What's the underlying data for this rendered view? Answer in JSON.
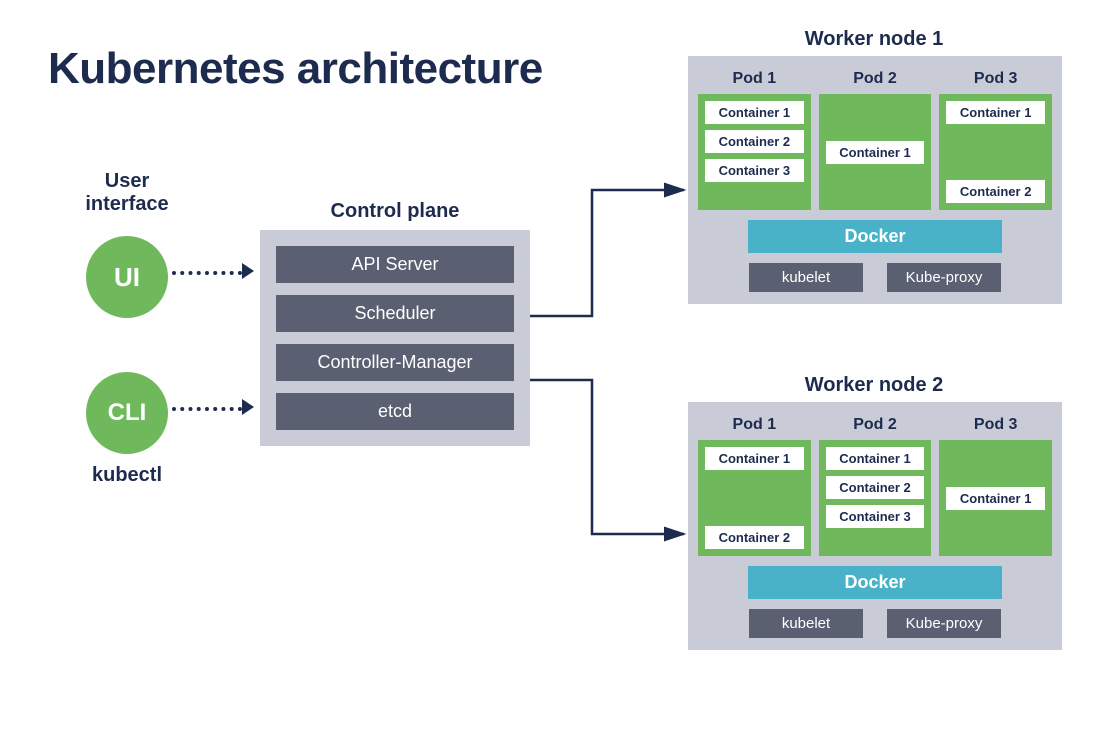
{
  "title": "Kubernetes architecture",
  "ui_section": {
    "heading": "User\ninterface",
    "ui_label": "UI",
    "cli_label": "CLI",
    "kubectl": "kubectl"
  },
  "control_plane": {
    "heading": "Control plane",
    "items": [
      "API Server",
      "Scheduler",
      "Controller-Manager",
      "etcd"
    ]
  },
  "worker_nodes": [
    {
      "title": "Worker node 1",
      "pods": [
        {
          "label": "Pod 1",
          "containers": [
            "Container 1",
            "Container 2",
            "Container 3"
          ]
        },
        {
          "label": "Pod 2",
          "containers": [
            "Container 1"
          ]
        },
        {
          "label": "Pod 3",
          "containers": [
            "Container 1",
            "Container 2"
          ]
        }
      ],
      "docker": "Docker",
      "services": [
        "kubelet",
        "Kube-proxy"
      ]
    },
    {
      "title": "Worker node 2",
      "pods": [
        {
          "label": "Pod 1",
          "containers": [
            "Container 1",
            "Container 2"
          ]
        },
        {
          "label": "Pod 2",
          "containers": [
            "Container 1",
            "Container 2",
            "Container 3"
          ]
        },
        {
          "label": "Pod 3",
          "containers": [
            "Container 1"
          ]
        }
      ],
      "docker": "Docker",
      "services": [
        "kubelet",
        "Kube-proxy"
      ]
    }
  ],
  "colors": {
    "accent_green": "#6fb95c",
    "panel_gray": "#c9cbd6",
    "block_gray": "#5a5f72",
    "docker_cyan": "#49b2c9",
    "text_navy": "#1d2b4f"
  }
}
